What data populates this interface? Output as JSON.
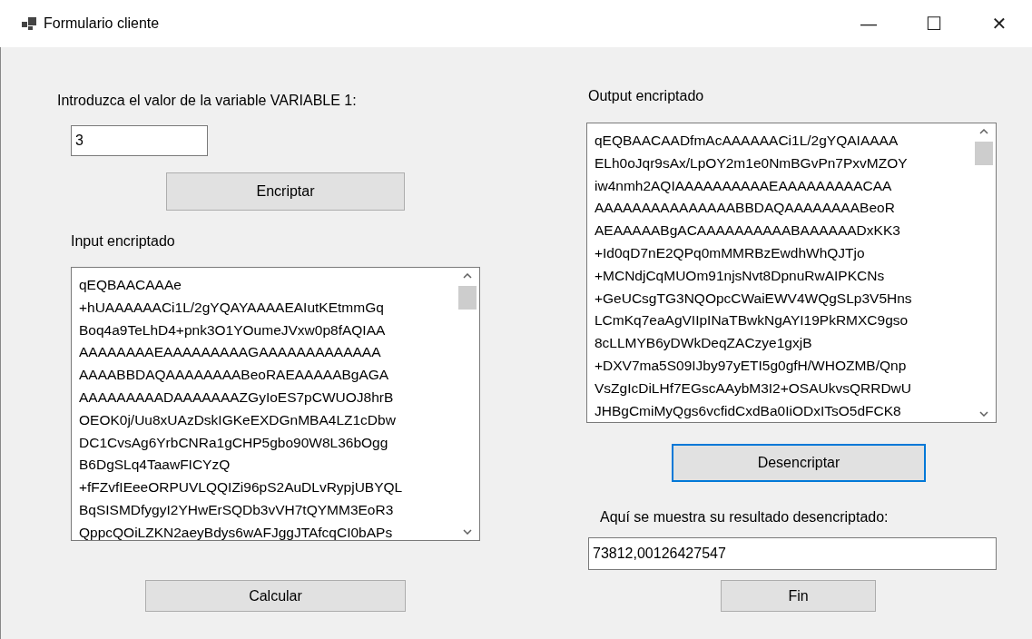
{
  "window": {
    "title": "Formulario cliente",
    "controls": [
      "—",
      "☐",
      "✕"
    ]
  },
  "left": {
    "prompt": "Introduzca el valor de la variable VARIABLE 1:",
    "value_field": {
      "value": "3"
    },
    "encrypt_button": "Encriptar",
    "input_label": "Input encriptado",
    "input_text": [
      "qEQBAACAAAe",
      "+hUAAAAAACi1L/2gYQAYAAAAEAIutKEtmmGq",
      "Boq4a9TeLhD4+pnk3O1YOumeJVxw0p8fAQIAA",
      "AAAAAAAAEAAAAAAAAAGAAAAAAAAAAAAA",
      "AAAABBDAQAAAAAAAABeoRAEAAAAABgAGA",
      "AAAAAAAAADAAAAAAAZGyIoES7pCWUOJ8hrB",
      "OEOK0j/Uu8xUAzDskIGKeEXDGnMBA4LZ1cDbw",
      "DC1CvsAg6YrbCNRa1gCHP5gbo90W8L36bOgg",
      "B6DgSLq4TaawFICYzQ",
      "+fFZvfIEeeORPUVLQQIZi96pS2AuDLvRypjUBYQL",
      "BqSISMDfygyI2YHwErSQDb3vVH7tQYMM3EoR3",
      "QppcQOiLZKN2aeyBdys6wAFJggJTAfcqCI0bAPs"
    ],
    "calc_button": "Calcular"
  },
  "right": {
    "output_label": "Output encriptado",
    "output_text": [
      "qEQBAACAADfmAcAAAAAACi1L/2gYQAIAAAA",
      "ELh0oJqr9sAx/LpOY2m1e0NmBGvPn7PxvMZOY",
      "iw4nmh2AQIAAAAAAAAAAEAAAAAAAAACAA",
      "AAAAAAAAAAAAAAABBDAQAAAAAAAABeoR",
      "AEAAAAABgACAAAAAAAAAABAAAAAADxKK3",
      "+Id0qD7nE2QPq0mMMRBzEwdhWhQJTjo",
      "+MCNdjCqMUOm91njsNvt8DpnuRwAIPKCNs",
      "+GeUCsgTG3NQOpcCWaiEWV4WQgSLp3V5Hns",
      "LCmKq7eaAgVIIpINaTBwkNgAYI19PkRMXC9gso",
      "8cLLMYB6yDWkDeqZACzye1gxjB",
      "+DXV7ma5S09IJby97yETI5g0gfH/WHOZMB/Qnp",
      "VsZgIcDiLHf7EGscAAybM3I2+OSAUkvsQRRDwU",
      "JHBgCmiMyQgs6vcfidCxdBa0IiODxITsO5dFCK8"
    ],
    "decrypt_button": {
      "label": "Desencriptar",
      "focused": true
    },
    "result_label": "Aquí se muestra su resultado desencriptado:",
    "result_field": {
      "value": "73812,00126427547"
    },
    "end_button": "Fin"
  }
}
